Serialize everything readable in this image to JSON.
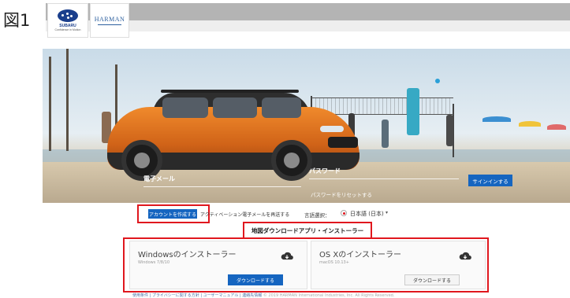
{
  "figure_label": "図1",
  "logos": {
    "subaru": {
      "brand": "SUBARU",
      "tagline": "Confidence in Motion"
    },
    "harman": {
      "brand": "HARMAN"
    }
  },
  "signin": {
    "email_label": "電子メール",
    "password_label": "パスワード",
    "signin_button": "サインインする",
    "reset_password_link": "パスワードをリセットする"
  },
  "account": {
    "create_button": "アカウントを作成する",
    "resend_link": "アクティベーション電子メールを再送する"
  },
  "language": {
    "label": "言語選択：",
    "selected": "日本語 (日本)",
    "caret": "▾"
  },
  "downloads": {
    "heading": "地図ダウンロードアプリ・インストーラー",
    "windows": {
      "title": "Windowsのインストーラー",
      "subtitle": "Windows 7/8/10",
      "button": "ダウンロードする"
    },
    "mac": {
      "title": "OS Xのインストーラー",
      "subtitle": "macOS 10.13+",
      "button": "ダウンロードする"
    }
  },
  "footer": {
    "links": "使用条件 | プライバシーに関する方針 | ユーザーマニュアル | 連絡先情報",
    "copyright": "© 2019 HARMAN International Industries, Inc. All Rights Reserved."
  },
  "colors": {
    "accent_blue": "#1565c0",
    "highlight_red": "#e0171e",
    "car_orange": "#e67a22"
  },
  "icons": [
    "cloud-download-icon",
    "radio-selected-icon",
    "caret-down-icon"
  ]
}
